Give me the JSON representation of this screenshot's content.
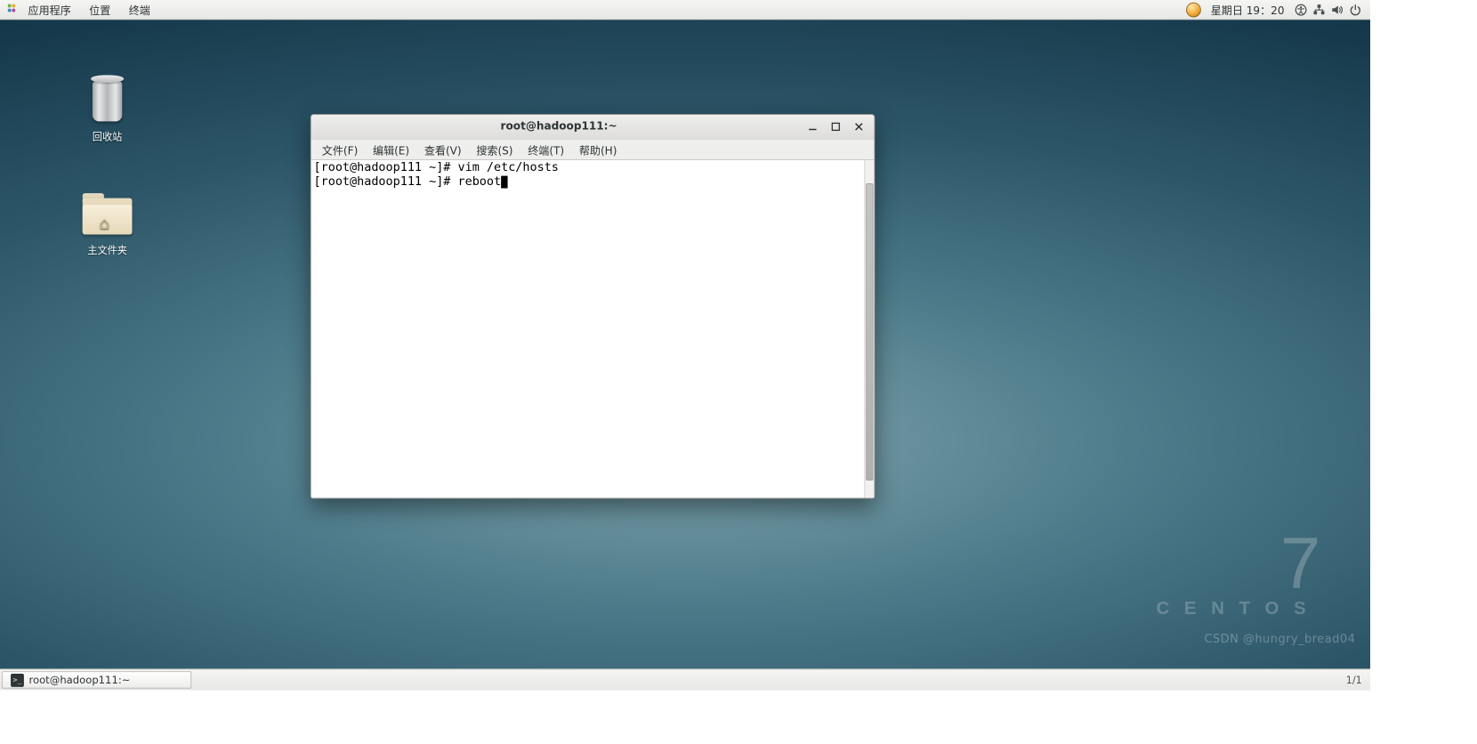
{
  "topbar": {
    "menu": {
      "applications": "应用程序",
      "places": "位置",
      "terminal": "终端"
    },
    "clock": "星期日 19：20"
  },
  "desktop": {
    "trash_label": "回收站",
    "home_label": "主文件夹",
    "centos_num": "7",
    "centos_word": "CENTOS"
  },
  "window": {
    "title": "root@hadoop111:~",
    "menubar": {
      "file": "文件(F)",
      "edit": "编辑(E)",
      "view": "查看(V)",
      "search": "搜索(S)",
      "terminal": "终端(T)",
      "help": "帮助(H)"
    },
    "lines": [
      "[root@hadoop111 ~]# vim /etc/hosts",
      "[root@hadoop111 ~]# reboot"
    ]
  },
  "taskbar": {
    "active_task": "root@hadoop111:~",
    "right": "1/1"
  },
  "watermark": "CSDN @hungry_bread04"
}
